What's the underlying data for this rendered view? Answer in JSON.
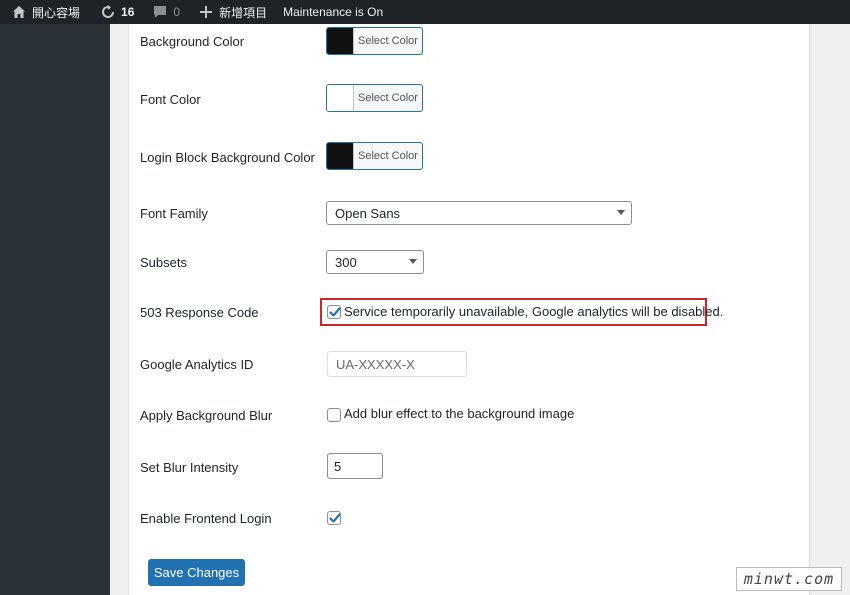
{
  "adminbar": {
    "site_name": "開心容場",
    "updates_count": "16",
    "comments_count": "0",
    "new_label": "新增項目",
    "maintenance_label": "Maintenance is On"
  },
  "settings": {
    "background_color": {
      "label": "Background Color",
      "button": "Select Color",
      "swatch": "#111111"
    },
    "font_color": {
      "label": "Font Color",
      "button": "Select Color",
      "swatch": "#ffffff"
    },
    "login_block_bg": {
      "label": "Login Block Background Color",
      "button": "Select Color",
      "swatch": "#111111"
    },
    "font_family": {
      "label": "Font Family",
      "value": "Open Sans"
    },
    "subsets": {
      "label": "Subsets",
      "value": "300"
    },
    "response_code": {
      "label": "503 Response Code",
      "checkbox_text": "Service temporarily unavailable, Google analytics will be disabled.",
      "checked": true
    },
    "analytics_id": {
      "label": "Google Analytics ID",
      "placeholder": "UA-XXXXX-X"
    },
    "background_blur": {
      "label": "Apply Background Blur",
      "checkbox_text": "Add blur effect to the background image",
      "checked": false
    },
    "blur_intensity": {
      "label": "Set Blur Intensity",
      "value": "5"
    },
    "frontend_login": {
      "label": "Enable Frontend Login",
      "checked": true
    }
  },
  "save_button": "Save Changes",
  "watermark": "minwt.com",
  "colors": {
    "accent": "#2271b1",
    "highlight_border": "#c6262e",
    "adminbar_bg": "#1d2327"
  }
}
